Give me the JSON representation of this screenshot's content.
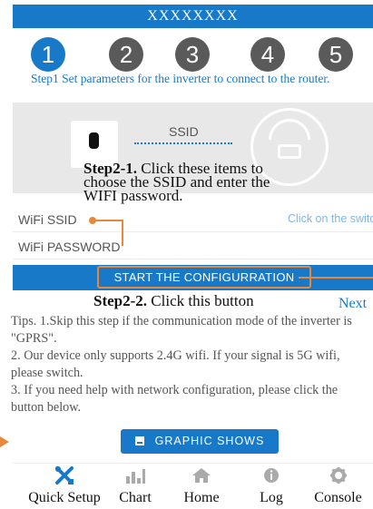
{
  "header": {
    "title": "XXXXXXXX"
  },
  "steps": {
    "items": [
      "1",
      "2",
      "3",
      "4",
      "5"
    ],
    "active_index": 0,
    "description": "Step1 Set parameters for the inverter to connect to the router."
  },
  "illustration": {
    "ssid_label": "SSID"
  },
  "callout_step2_1": {
    "bold": "Step2-1.",
    "text": " Click these items to choose the SSID and enter the WIFI password."
  },
  "form": {
    "wifi_ssid_label": "WiFi SSID",
    "wifi_ssid_hint": "Click on the switch",
    "wifi_password_label": "WiFi PASSWORD"
  },
  "config_button": {
    "label": "START THE CONFIGURRATION"
  },
  "callout_step2_2": {
    "bold": "Step2-2.",
    "text": " Click this button"
  },
  "next_link": "Next",
  "tips": {
    "line1": "Tips. 1.Skip this step if the communication mode of the inverter is \"GPRS\".",
    "line2": "2. Our device only supports 2.4G wifi. If your signal is 5G wifi, please switch.",
    "line3": "3. If you need help with network configuration, please click the button below."
  },
  "graphic_button": {
    "label": "GRAPHIC SHOWS"
  },
  "tabbar": {
    "quick_setup": "Quick Setup",
    "chart": "Chart",
    "home": "Home",
    "log": "Log",
    "console": "Console"
  },
  "colors": {
    "primary": "#1779c8",
    "annotation": "#e8883a",
    "inactive_step": "#5a5a5a"
  }
}
